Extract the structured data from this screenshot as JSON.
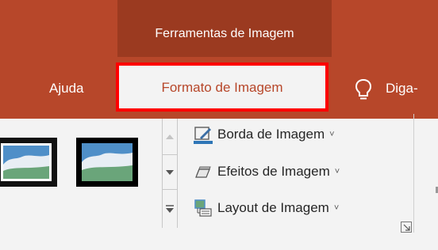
{
  "context_tab_group": {
    "label": "Ferramentas de Imagem"
  },
  "tabs": {
    "ajuda": "Ajuda",
    "formato_de_imagem": "Formato de Imagem",
    "tell_me": "Diga-"
  },
  "picture_styles": {
    "commands": [
      {
        "label": "Borda de Imagem",
        "icon": "picture-border-icon"
      },
      {
        "label": "Efeitos de Imagem",
        "icon": "picture-effects-icon"
      },
      {
        "label": "Layout de Imagem",
        "icon": "picture-layout-icon"
      }
    ],
    "dropdown_glyph": "˅"
  },
  "colors": {
    "ribbon_accent": "#b7472a",
    "context_group": "#9b3a20",
    "highlight_box": "#ff0000",
    "ribbon_body": "#f3f3f3"
  }
}
